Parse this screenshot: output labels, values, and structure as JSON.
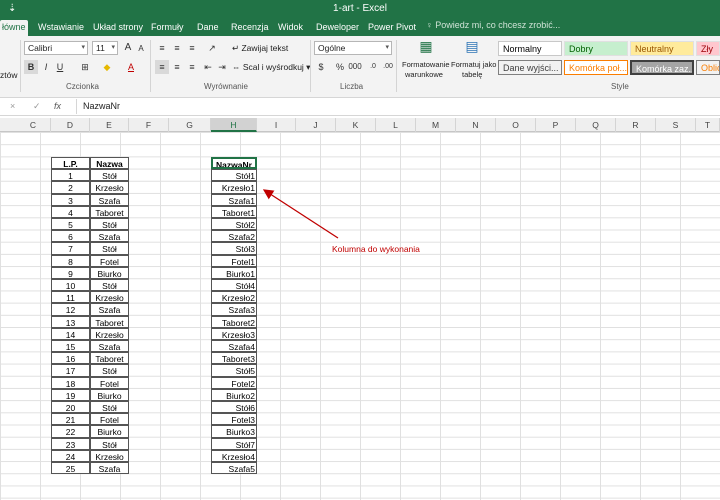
{
  "titlebar": {
    "title": "1-art - Excel",
    "quick_access": "⇣"
  },
  "tabs": {
    "items": [
      {
        "label": "łówne",
        "active": true
      },
      {
        "label": "Wstawianie"
      },
      {
        "label": "Układ strony"
      },
      {
        "label": "Formuły"
      },
      {
        "label": "Dane"
      },
      {
        "label": "Recenzja"
      },
      {
        "label": "Widok"
      },
      {
        "label": "Deweloper"
      },
      {
        "label": "Power Pivot"
      }
    ],
    "tell_me": "Powiedz mi, co chcesz zrobić..."
  },
  "ribbon": {
    "clipboard_label": "ztów",
    "font_name": "Calibri",
    "font_size": "11",
    "font_group_label": "Czcionka",
    "wrap_text": "Zawijaj tekst",
    "merge_center": "Scal i wyśrodkuj",
    "alignment_group_label": "Wyrównanie",
    "number_format": "Ogólne",
    "number_group_label": "Liczba",
    "conditional_formatting_1": "Formatowanie",
    "conditional_formatting_2": "warunkowe",
    "format_table_1": "Formatuj jako",
    "format_table_2": "tabelę",
    "styles": [
      {
        "label": "Normalny",
        "bg": "#ffffff",
        "fg": "#000000"
      },
      {
        "label": "Dobry",
        "bg": "#c6efce",
        "fg": "#006100"
      },
      {
        "label": "Neutralny",
        "bg": "#ffeb9c",
        "fg": "#9c5700"
      },
      {
        "label": "Zły",
        "bg": "#ffc7ce",
        "fg": "#9c0006"
      },
      {
        "label": "Dane wyjści...",
        "bg": "#f2f2f2",
        "fg": "#3f3f3f"
      },
      {
        "label": "Komórka poł...",
        "bg": "#ffffff",
        "fg": "#fa7d00"
      },
      {
        "label": "Komórka zaz...",
        "bg": "#a5a5a5",
        "fg": "#ffffff"
      },
      {
        "label": "Oblicz",
        "bg": "#f2f2f2",
        "fg": "#fa7d00"
      }
    ],
    "styles_group_label": "Style"
  },
  "formula_bar": {
    "name_box_icons": "× ✓",
    "fx": "fx",
    "value": "NazwaNr"
  },
  "columns": [
    {
      "label": "C"
    },
    {
      "label": "D"
    },
    {
      "label": "E"
    },
    {
      "label": "F"
    },
    {
      "label": "G"
    },
    {
      "label": "H",
      "selected": true
    },
    {
      "label": "I"
    },
    {
      "label": "J"
    },
    {
      "label": "K"
    },
    {
      "label": "L"
    },
    {
      "label": "M"
    },
    {
      "label": "N"
    },
    {
      "label": "O"
    },
    {
      "label": "P"
    },
    {
      "label": "Q"
    },
    {
      "label": "R"
    },
    {
      "label": "S"
    },
    {
      "label": "T"
    }
  ],
  "table1": {
    "headers": [
      "L.P.",
      "Nazwa"
    ],
    "rows": [
      [
        "1",
        "Stół"
      ],
      [
        "2",
        "Krzesło"
      ],
      [
        "3",
        "Szafa"
      ],
      [
        "4",
        "Taboret"
      ],
      [
        "5",
        "Stół"
      ],
      [
        "6",
        "Szafa"
      ],
      [
        "7",
        "Stół"
      ],
      [
        "8",
        "Fotel"
      ],
      [
        "9",
        "Biurko"
      ],
      [
        "10",
        "Stół"
      ],
      [
        "11",
        "Krzesło"
      ],
      [
        "12",
        "Szafa"
      ],
      [
        "13",
        "Taboret"
      ],
      [
        "14",
        "Krzesło"
      ],
      [
        "15",
        "Szafa"
      ],
      [
        "16",
        "Taboret"
      ],
      [
        "17",
        "Stół"
      ],
      [
        "18",
        "Fotel"
      ],
      [
        "19",
        "Biurko"
      ],
      [
        "20",
        "Stół"
      ],
      [
        "21",
        "Fotel"
      ],
      [
        "22",
        "Biurko"
      ],
      [
        "23",
        "Stół"
      ],
      [
        "24",
        "Krzesło"
      ],
      [
        "25",
        "Szafa"
      ]
    ]
  },
  "table2": {
    "header": "NazwaNr",
    "rows": [
      "Stół1",
      "Krzesło1",
      "Szafa1",
      "Taboret1",
      "Stół2",
      "Szafa2",
      "Stół3",
      "Fotel1",
      "Biurko1",
      "Stół4",
      "Krzesło2",
      "Szafa3",
      "Taboret2",
      "Krzesło3",
      "Szafa4",
      "Taboret3",
      "Stół5",
      "Fotel2",
      "Biurko2",
      "Stół6",
      "Fotel3",
      "Biurko3",
      "Stół7",
      "Krzesło4",
      "Szafa5"
    ]
  },
  "annotation": {
    "text": "Kolumna do wykonania",
    "color": "#c00000"
  }
}
